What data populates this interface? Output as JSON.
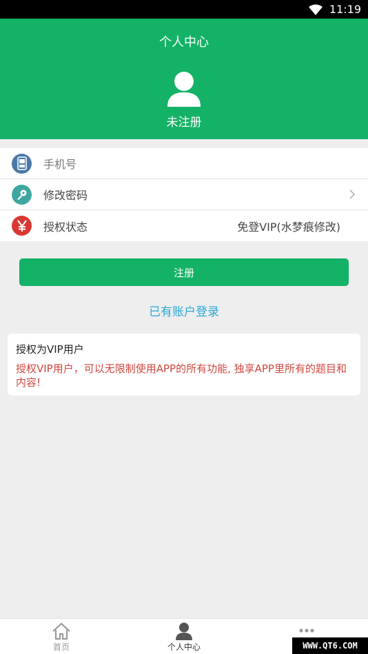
{
  "status_bar": {
    "time": "11:19"
  },
  "header": {
    "title": "个人中心",
    "username": "未注册"
  },
  "list": {
    "phone": {
      "label": "手机号",
      "icon": "phone-icon"
    },
    "password": {
      "label": "修改密码",
      "icon": "key-icon"
    },
    "auth": {
      "label": "授权状态",
      "value": "免登VIP(水梦痕修改)",
      "icon": "yen-icon"
    }
  },
  "register_button": "注册",
  "login_link": "已有账户登录",
  "vip_card": {
    "title": "授权为VIP用户",
    "text": "授权VIP用户，可以无限制使用APP的所有功能, 独享APP里所有的题目和内容!"
  },
  "tabbar": {
    "home": "首页",
    "profile": "个人中心"
  },
  "watermark": "WWW.QT6.COM",
  "colors": {
    "primary": "#14b266",
    "link": "#2aa7d6",
    "warning_text": "#d0463e"
  }
}
